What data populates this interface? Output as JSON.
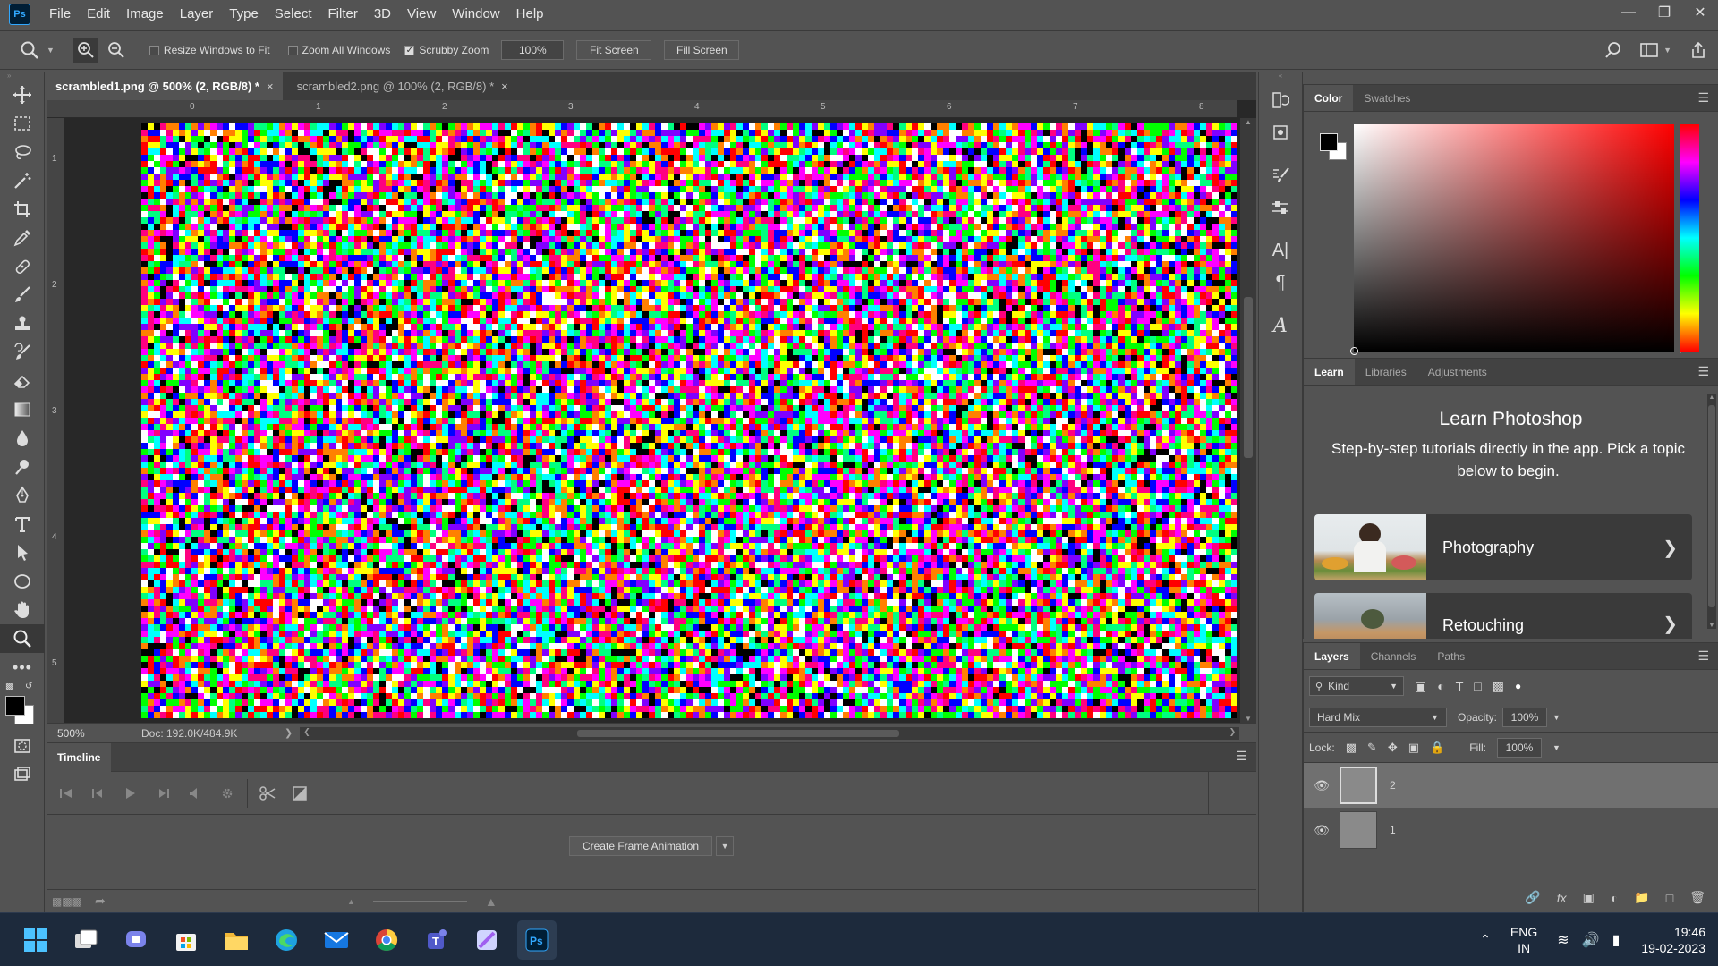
{
  "app": {
    "logo_text": "Ps",
    "accent": "#31a8ff"
  },
  "menu": [
    "File",
    "Edit",
    "Image",
    "Layer",
    "Type",
    "Select",
    "Filter",
    "3D",
    "View",
    "Window",
    "Help"
  ],
  "options_bar": {
    "resize_windows": "Resize Windows to Fit",
    "zoom_all": "Zoom All Windows",
    "scrubby_zoom": "Scrubby Zoom",
    "zoom_value": "100%",
    "fit_screen": "Fit Screen",
    "fill_screen": "Fill Screen",
    "resize_checked": false,
    "zoom_all_checked": false,
    "scrubby_checked": true
  },
  "tabs": [
    {
      "label": "scrambled1.png @ 500% (2, RGB/8) *",
      "close": "×"
    },
    {
      "label": "scrambled2.png @ 100% (2, RGB/8) *",
      "close": "×"
    }
  ],
  "ruler": {
    "h_ticks": [
      "0",
      "1",
      "2",
      "3",
      "4",
      "5",
      "6",
      "7",
      "8"
    ],
    "v_ticks": [
      "1",
      "2",
      "3",
      "4",
      "5"
    ]
  },
  "status": {
    "zoom": "500%",
    "doc": "Doc: 192.0K/484.9K"
  },
  "timeline": {
    "title": "Timeline",
    "create_button": "Create Frame Animation"
  },
  "color_panel": {
    "tabs": [
      "Color",
      "Swatches"
    ]
  },
  "learn_panel": {
    "tabs": [
      "Learn",
      "Libraries",
      "Adjustments"
    ],
    "heading": "Learn Photoshop",
    "desc": "Step-by-step tutorials directly in the app. Pick a topic below to begin.",
    "topics": [
      "Photography",
      "Retouching"
    ]
  },
  "layers_panel": {
    "tabs": [
      "Layers",
      "Channels",
      "Paths"
    ],
    "filter": "Kind",
    "blend_mode": "Hard Mix",
    "opacity_label": "Opacity:",
    "opacity": "100%",
    "lock_label": "Lock:",
    "fill_label": "Fill:",
    "fill": "100%",
    "layers": [
      {
        "name": "2",
        "selected": true
      },
      {
        "name": "1",
        "selected": false
      }
    ]
  },
  "taskbar": {
    "lang": "ENG",
    "region": "IN",
    "time": "19:46",
    "date": "19-02-2023"
  }
}
